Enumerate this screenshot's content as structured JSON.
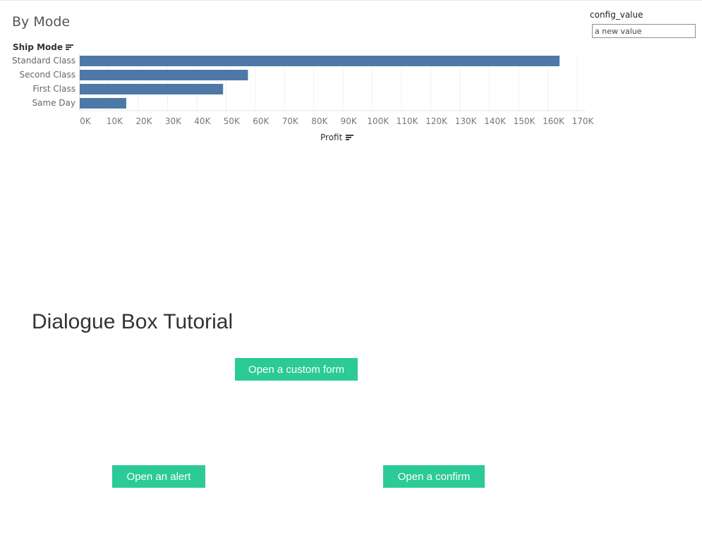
{
  "dashboard": {
    "title": "By Mode",
    "config": {
      "label": "config_value",
      "placeholder": "a new value"
    }
  },
  "chart_data": {
    "type": "bar",
    "orientation": "horizontal",
    "row_header": "Ship Mode",
    "categories": [
      "Standard Class",
      "Second Class",
      "First Class",
      "Same Day"
    ],
    "values": [
      164000,
      57500,
      49000,
      15900
    ],
    "xlabel": "Profit",
    "xlim": [
      0,
      170000
    ],
    "x_ticks": [
      "0K",
      "10K",
      "20K",
      "30K",
      "40K",
      "50K",
      "60K",
      "70K",
      "80K",
      "90K",
      "100K",
      "110K",
      "120K",
      "130K",
      "140K",
      "150K",
      "160K",
      "170K"
    ],
    "bar_color": "#4e79a7",
    "grid": true
  },
  "tutorial": {
    "heading": "Dialogue Box Tutorial",
    "buttons": {
      "form": "Open a custom form",
      "alert": "Open an alert",
      "confirm": "Open a confirm"
    },
    "button_color": "#2bca96"
  }
}
